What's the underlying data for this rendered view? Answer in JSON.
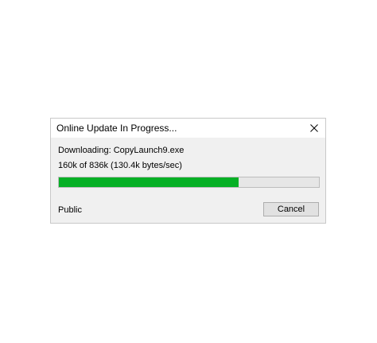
{
  "window": {
    "title": "Online Update In Progress..."
  },
  "titlebar": {
    "close_icon": "close-x-icon"
  },
  "status": {
    "downloading": "Downloading: CopyLaunch9.exe",
    "bytes": "160k of 836k (130.4k bytes/sec)"
  },
  "progress": {
    "percent": 69,
    "fill_color": "#06b025",
    "track_color": "#e6e6e6"
  },
  "footer": {
    "label": "Public",
    "cancel_label": "Cancel"
  }
}
